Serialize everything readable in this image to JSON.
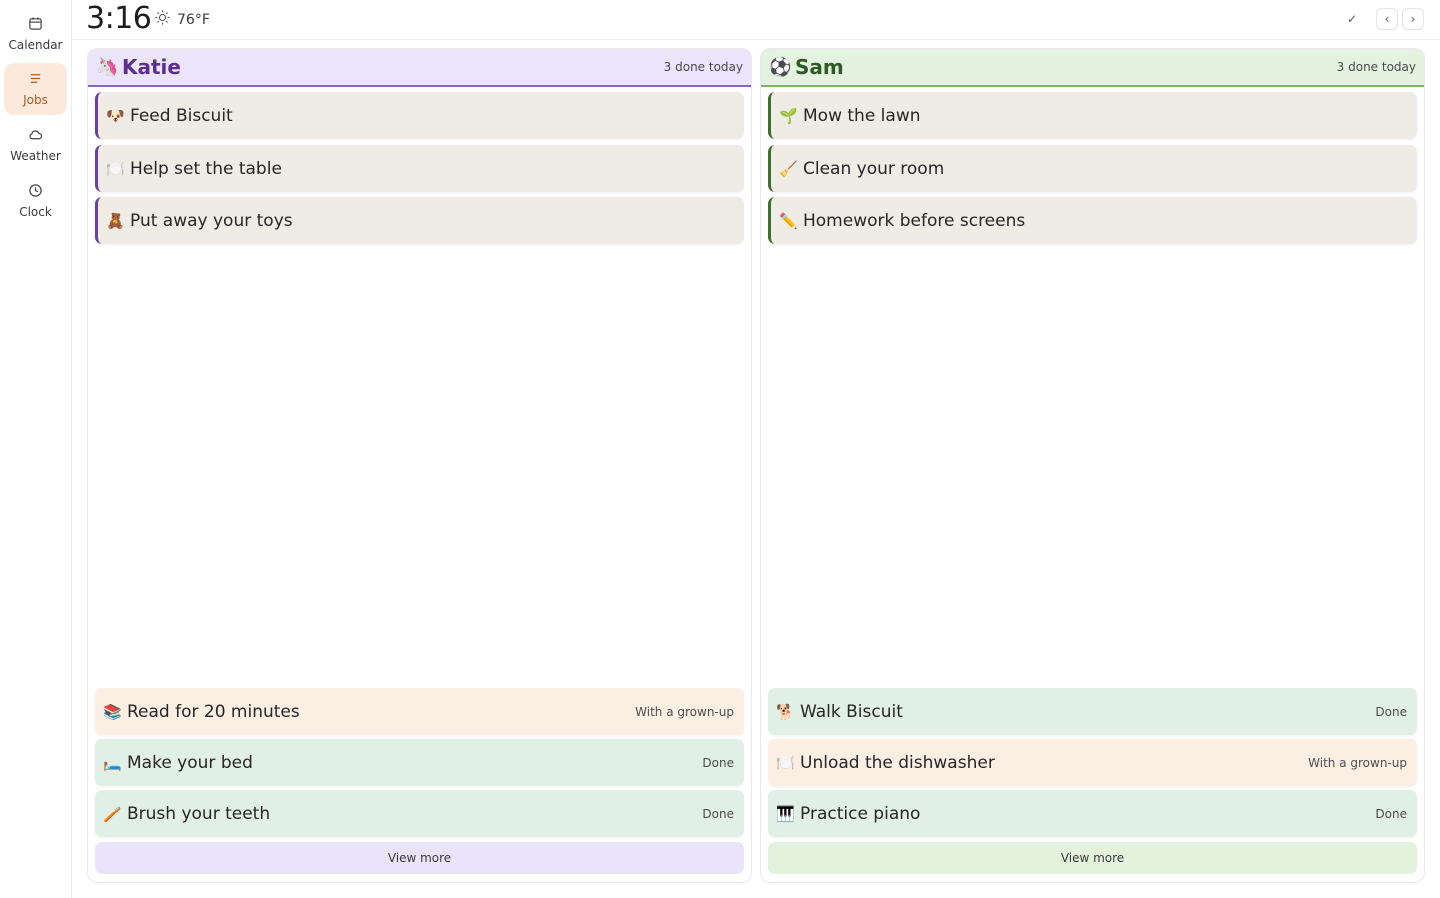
{
  "sidebar": {
    "items": [
      {
        "label": "Calendar",
        "icon": "calendar-icon",
        "active": false
      },
      {
        "label": "Jobs",
        "icon": "list-icon",
        "active": true
      },
      {
        "label": "Weather",
        "icon": "cloud-icon",
        "active": false
      },
      {
        "label": "Clock",
        "icon": "clock-icon",
        "active": false
      }
    ]
  },
  "header": {
    "time": "3:16",
    "weather": {
      "icon": "sun-icon",
      "temp": "76°F"
    },
    "actions": {
      "check": "✓",
      "prev": "‹",
      "next": "›"
    }
  },
  "columns": [
    {
      "name": "Katie",
      "emoji": "🦄",
      "done_count": "3 done today",
      "colors": {
        "header_bg": "#ebe5fb",
        "accent": "#6b3fa0",
        "name": "#5b2e8f",
        "view_more_bg": "#e9e4fb"
      },
      "tasks": [
        {
          "icon": "🐶",
          "label": "Feed Biscuit"
        },
        {
          "icon": "🍽️",
          "label": "Help set the table"
        },
        {
          "icon": "🧸",
          "label": "Put away your toys"
        }
      ],
      "bottom_tasks": [
        {
          "icon": "📚",
          "label": "Read for 20 minutes",
          "status": "With a grown-up",
          "bg": "#fbeee3"
        },
        {
          "icon": "🛏️",
          "label": "Make your bed",
          "status": "Done",
          "bg": "#e1f0e6"
        },
        {
          "icon": "🪥",
          "label": "Brush your teeth",
          "status": "Done",
          "bg": "#e1f0e6"
        }
      ],
      "view_more": "View more"
    },
    {
      "name": "Sam",
      "emoji": "⚽",
      "done_count": "3 done today",
      "colors": {
        "header_bg": "#e3f3df",
        "accent": "#3f6e2e",
        "name": "#2f5a25",
        "view_more_bg": "#e2f2dc"
      },
      "tasks": [
        {
          "icon": "🌱",
          "label": "Mow the lawn"
        },
        {
          "icon": "🧹",
          "label": "Clean your room"
        },
        {
          "icon": "✏️",
          "label": "Homework before screens"
        }
      ],
      "bottom_tasks": [
        {
          "icon": "🐕",
          "label": "Walk Biscuit",
          "status": "Done",
          "bg": "#e1f0e6"
        },
        {
          "icon": "🍽️",
          "label": "Unload the dishwasher",
          "status": "With a grown-up",
          "bg": "#fbeee3"
        },
        {
          "icon": "🎹",
          "label": "Practice piano",
          "status": "Done",
          "bg": "#e1f0e6"
        }
      ],
      "view_more": "View more"
    }
  ]
}
